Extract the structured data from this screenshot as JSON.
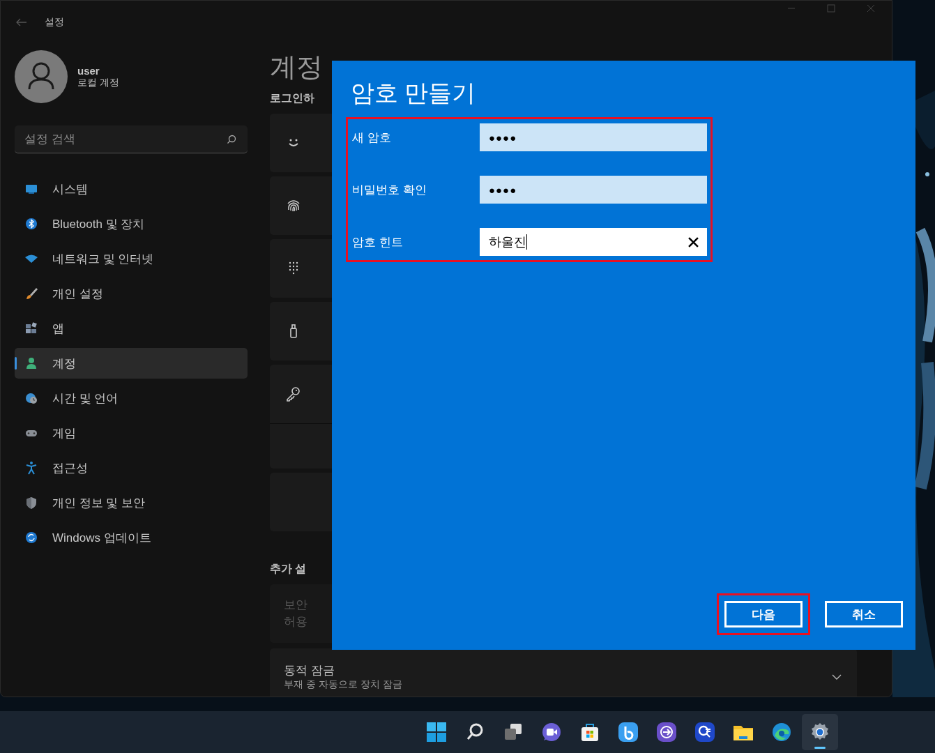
{
  "window": {
    "title": "설정"
  },
  "user": {
    "name": "user",
    "account_type": "로컬 계정"
  },
  "search": {
    "placeholder": "설정 검색"
  },
  "nav": [
    {
      "label": "시스템",
      "selected": false
    },
    {
      "label": "Bluetooth 및 장치",
      "selected": false
    },
    {
      "label": "네트워크 및 인터넷",
      "selected": false
    },
    {
      "label": "개인 설정",
      "selected": false
    },
    {
      "label": "앱",
      "selected": false
    },
    {
      "label": "계정",
      "selected": true
    },
    {
      "label": "시간 및 언어",
      "selected": false
    },
    {
      "label": "게임",
      "selected": false
    },
    {
      "label": "접근성",
      "selected": false
    },
    {
      "label": "개인 정보 및 보안",
      "selected": false
    },
    {
      "label": "Windows 업데이트",
      "selected": false
    }
  ],
  "page": {
    "heading": "계정",
    "section": "로그인하",
    "more_heading": "추가 설",
    "more_card_lines": [
      "보안",
      "허용"
    ],
    "dynamic_lock": {
      "title": "동적 잠금",
      "description": "부재 중 자동으로 장치 잠금"
    }
  },
  "dialog": {
    "title": "암호 만들기",
    "fields_highlighted": true,
    "fields": [
      {
        "label": "새 암호",
        "kind": "password",
        "value": "●●●●"
      },
      {
        "label": "비밀번호 확인",
        "kind": "password",
        "value": "●●●●"
      },
      {
        "label": "암호 힌트",
        "kind": "text",
        "value": "하울진"
      }
    ],
    "buttons": [
      {
        "label": "다음",
        "highlighted": true
      },
      {
        "label": "취소",
        "highlighted": false
      }
    ]
  },
  "taskbar": {
    "items": [
      {
        "selected": false
      },
      {
        "selected": false
      },
      {
        "selected": false
      },
      {
        "selected": false
      },
      {
        "selected": false
      },
      {
        "selected": false
      },
      {
        "selected": false
      },
      {
        "selected": false
      },
      {
        "selected": false
      },
      {
        "selected": false
      },
      {
        "selected": true
      }
    ]
  }
}
